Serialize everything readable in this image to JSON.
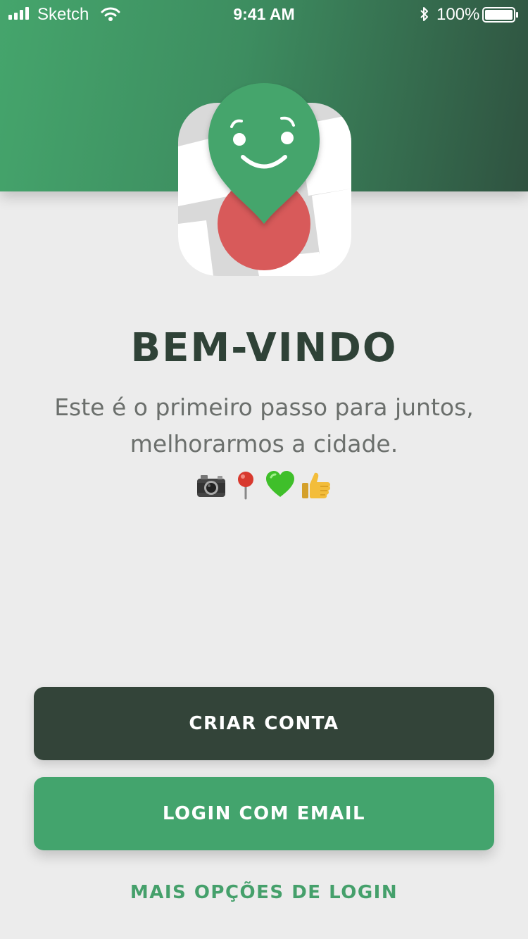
{
  "status_bar": {
    "carrier": "Sketch",
    "time": "9:41 AM",
    "battery": "100%"
  },
  "app_icon": {
    "name": "app-logo-icon",
    "colors": {
      "pin": "#45a56c",
      "blob": "#d85a5a",
      "map": "#d9d9d9"
    }
  },
  "welcome": {
    "title": "BEM-VINDO",
    "subtitle_line1": "Este é o primeiro passo para juntos,",
    "subtitle_line2": "melhorarmos a cidade.",
    "emojis": [
      "camera-icon",
      "pin-icon",
      "green-heart-icon",
      "thumbs-up-icon"
    ]
  },
  "actions": {
    "create_account": "CRIAR CONTA",
    "login_email": "LOGIN COM EMAIL",
    "more_options": "MAIS OPÇÕES DE LOGIN"
  },
  "colors": {
    "header_start": "#45a56c",
    "header_end": "#2f5240",
    "dark_button": "#334439",
    "green_button": "#43a46d",
    "link": "#45a06b",
    "title": "#2f4237",
    "background": "#ececec"
  }
}
